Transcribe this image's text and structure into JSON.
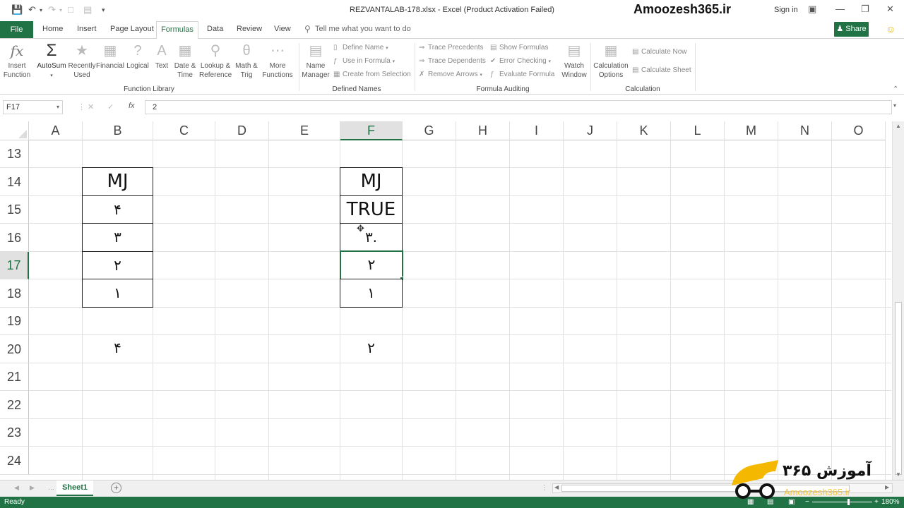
{
  "titlebar": {
    "document_title": "REZVANTALAB-178.xlsx - Excel (Product Activation Failed)",
    "brand": "Amoozesh365.ir",
    "sign_in": "Sign in"
  },
  "tabs": {
    "file": "File",
    "home": "Home",
    "insert": "Insert",
    "page_layout": "Page Layout",
    "formulas": "Formulas",
    "data": "Data",
    "review": "Review",
    "view": "View",
    "tell_me": "Tell me what you want to do",
    "share": "Share"
  },
  "ribbon": {
    "function_library": {
      "label": "Function Library",
      "insert_function": [
        "Insert",
        "Function"
      ],
      "autosum": "AutoSum",
      "recently_used": [
        "Recently",
        "Used"
      ],
      "financial": "Financial",
      "logical": "Logical",
      "text": "Text",
      "date_time": [
        "Date &",
        "Time"
      ],
      "lookup_reference": [
        "Lookup &",
        "Reference"
      ],
      "math_trig": [
        "Math &",
        "Trig"
      ],
      "more_functions": [
        "More",
        "Functions"
      ]
    },
    "defined_names": {
      "label": "Defined Names",
      "name_manager": [
        "Name",
        "Manager"
      ],
      "define_name": "Define Name",
      "use_in_formula": "Use in Formula",
      "create_from_selection": "Create from Selection"
    },
    "formula_auditing": {
      "label": "Formula Auditing",
      "trace_precedents": "Trace Precedents",
      "trace_dependents": "Trace Dependents",
      "remove_arrows": "Remove Arrows",
      "show_formulas": "Show Formulas",
      "error_checking": "Error Checking",
      "evaluate_formula": "Evaluate Formula",
      "watch_window": [
        "Watch",
        "Window"
      ]
    },
    "calculation": {
      "label": "Calculation",
      "calculation_options": [
        "Calculation",
        "Options"
      ],
      "calculate_now": "Calculate Now",
      "calculate_sheet": "Calculate Sheet"
    }
  },
  "formula_bar": {
    "name_box": "F17",
    "fx": "fx",
    "value": "2"
  },
  "grid": {
    "columns": [
      "A",
      "B",
      "C",
      "D",
      "E",
      "F",
      "G",
      "H",
      "I",
      "J",
      "K",
      "L",
      "M",
      "N",
      "O"
    ],
    "selected_column": "F",
    "rows": [
      "13",
      "14",
      "15",
      "16",
      "17",
      "18",
      "19",
      "20",
      "21",
      "22",
      "23",
      "24"
    ],
    "selected_row": "17",
    "cells": {
      "B14": "MJ",
      "B15": "۴",
      "B16": "۳",
      "B17": "۲",
      "B18": "۱",
      "B20": "۴",
      "F14": "MJ",
      "F15": "TRUE",
      "F16": "۳.",
      "F17": "۲",
      "F18": "۱",
      "F20": "۲"
    }
  },
  "sheets": {
    "tabs": [
      "Sheet1"
    ],
    "active": "Sheet1"
  },
  "status": {
    "text": "Ready",
    "zoom": "180%"
  },
  "watermark": {
    "text": "آموزش ۳۶۵",
    "sub": "Amoozesh365.ir"
  },
  "colors": {
    "accent": "#217346",
    "logo_yellow": "#f5b800"
  }
}
